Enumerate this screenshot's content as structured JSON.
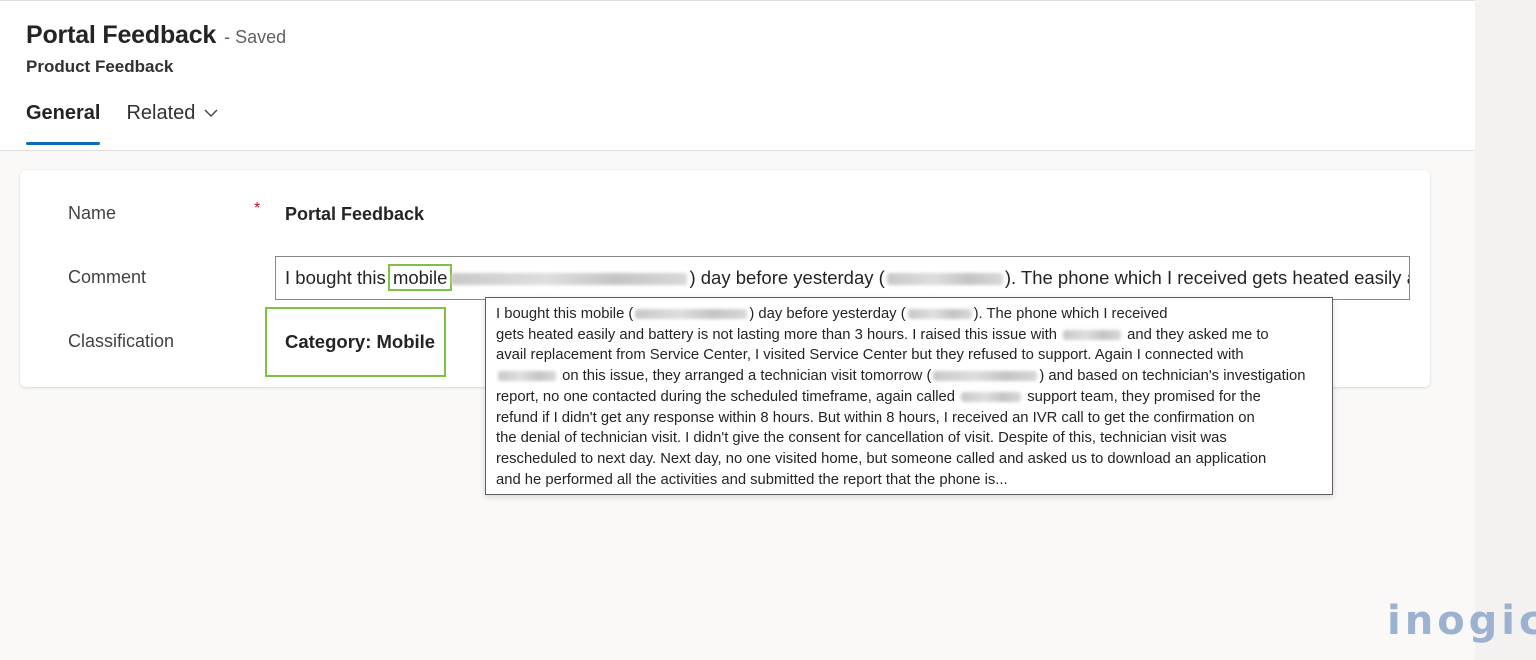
{
  "header": {
    "record_title": "Portal Feedback",
    "save_status": "- Saved",
    "entity_name": "Product Feedback",
    "tabs": [
      {
        "label": "General",
        "active": true
      },
      {
        "label": "Related",
        "active": false
      }
    ]
  },
  "form": {
    "name": {
      "label": "Name",
      "required_mark": "*",
      "value": "Portal Feedback"
    },
    "comment": {
      "label": "Comment",
      "value_before": "I bought this ",
      "highlighted_word": "mobile",
      "value_mid": ") day before yesterday (",
      "value_after": "). The phone which I received gets heated easily a..."
    },
    "classification": {
      "label": "Classification",
      "value": "Category: Mobile"
    }
  },
  "tooltip": {
    "segments": [
      [
        "I bought this mobile (",
        "@blur",
        ") day before yesterday (",
        "@blur",
        "). The phone which I received"
      ],
      [
        "gets heated easily and battery is not lasting more than 3 hours. I raised this issue with ",
        "@blur",
        " and they asked me to"
      ],
      [
        "avail replacement from Service Center, I visited Service Center but they refused to support. Again I connected with"
      ],
      [
        "@blur",
        " on this issue, they arranged a technician visit tomorrow (",
        "@blur",
        ") and based on technician's investigation"
      ],
      [
        "report, no one contacted during the scheduled timeframe, again called ",
        "@blur",
        " support team, they promised for the"
      ],
      [
        "refund if I didn't get any response within 8 hours. But within 8 hours, I received an IVR call to get the confirmation on"
      ],
      [
        "the denial of technician visit. I didn't give the consent for cancellation of visit. Despite of this, technician visit was"
      ],
      [
        "rescheduled to next day. Next day, no one visited home, but someone called and asked us to download an application"
      ],
      [
        "and he performed all the activities and submitted the report that the phone is..."
      ]
    ]
  },
  "watermark": {
    "text": "inogic"
  },
  "colors": {
    "accent": "#0f6cbd",
    "highlight": "#7dc243",
    "required": "#c50f1f"
  }
}
